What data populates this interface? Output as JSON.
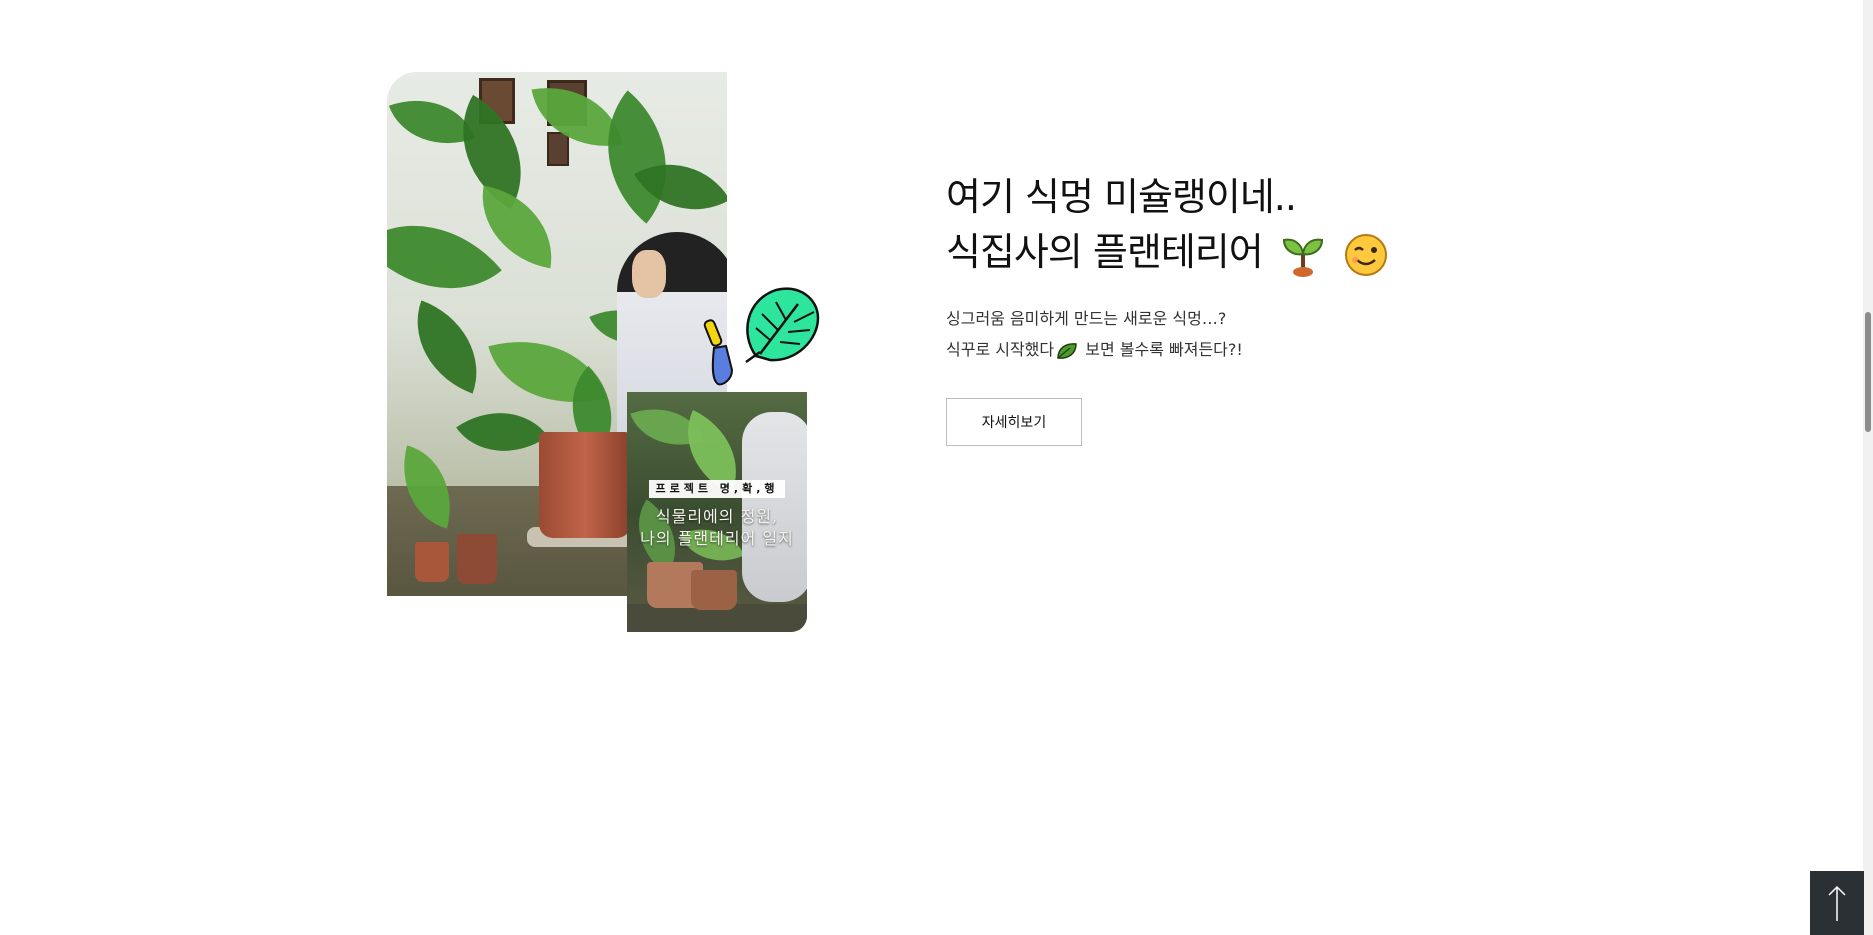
{
  "section": {
    "title_line1": "여기 식멍 미슐랭이네..",
    "title_line2": "식집사의 플랜테리어",
    "title_emojis": [
      "sprout-emoji",
      "wink-emoji"
    ],
    "desc_line1": "싱그러움 음미하게 만드는 새로운 식멍…?",
    "desc_line2_before": "식꾸로 시작했다",
    "desc_line2_after": " 보면 볼수록 빠져든다?!",
    "detail_button_label": "자세히보기"
  },
  "inset": {
    "tag": "프로젝트 명,확,행",
    "caption_line1": "식물리에의 정원,",
    "caption_line2": "나의 플랜테리어 일지"
  },
  "stickers": [
    "monstera-leaf-sticker",
    "trowel-sticker"
  ],
  "back_to_top": {
    "icon": "arrow-up-icon"
  },
  "colors": {
    "text": "#111111",
    "sticker_green": "#2ee59d",
    "top_button_bg": "#2b3035"
  }
}
